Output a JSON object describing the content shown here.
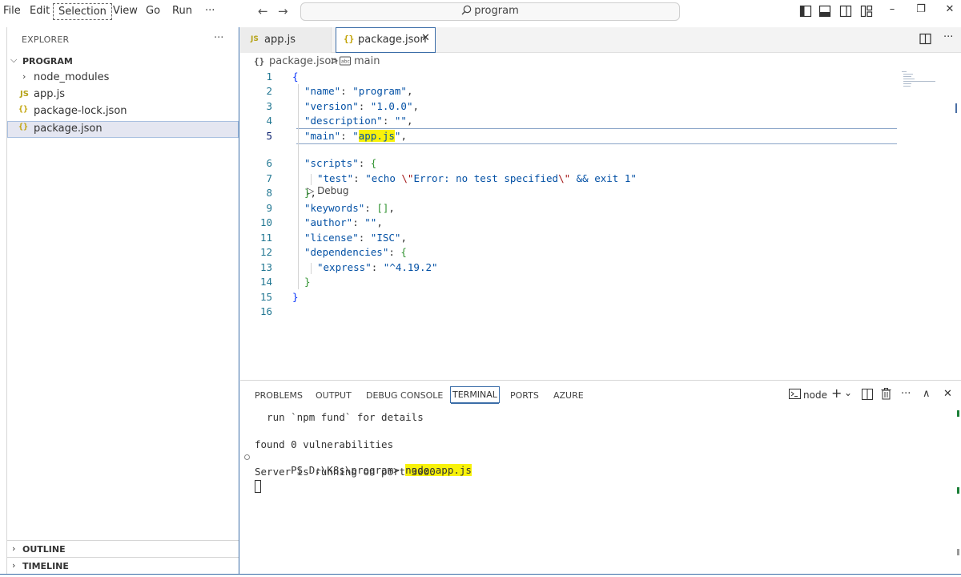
{
  "menu": {
    "items": [
      "File",
      "Edit",
      "Selection",
      "View",
      "Go",
      "Run"
    ],
    "more": "···"
  },
  "nav": {
    "back": "←",
    "forward": "→"
  },
  "command_center": {
    "text": "program"
  },
  "window_controls": {
    "minimize": "–",
    "restore": "❐",
    "close": "✕"
  },
  "sidebar": {
    "title": "EXPLORER",
    "more": "···",
    "folder": "PROGRAM",
    "items": [
      {
        "label": "node_modules",
        "kind": "folder"
      },
      {
        "label": "app.js",
        "kind": "js",
        "icon": "JS"
      },
      {
        "label": "package-lock.json",
        "kind": "json",
        "icon": "{}"
      },
      {
        "label": "package.json",
        "kind": "json",
        "icon": "{}",
        "selected": true
      }
    ],
    "sections": [
      "OUTLINE",
      "TIMELINE"
    ]
  },
  "tabs": [
    {
      "label": "app.js",
      "icon": "JS",
      "active": false
    },
    {
      "label": "package.json",
      "icon": "{}",
      "active": true,
      "close": "✕"
    }
  ],
  "breadcrumb": {
    "file": "package.json",
    "separator": ">",
    "symbol": "main"
  },
  "codelens": {
    "label": "Debug"
  },
  "code": {
    "line_numbers": [
      "1",
      "2",
      "3",
      "4",
      "5",
      "6",
      "7",
      "8",
      "9",
      "10",
      "11",
      "12",
      "13",
      "14",
      "15",
      "16"
    ],
    "active_line": 5
  },
  "panel": {
    "tabs": [
      "PROBLEMS",
      "OUTPUT",
      "DEBUG CONSOLE",
      "TERMINAL",
      "PORTS",
      "AZURE"
    ],
    "active_tab": "TERMINAL",
    "terminal_name": "node",
    "controls": {
      "add": "+",
      "dropdown": "⌄",
      "more": "···",
      "maximize": "∧",
      "close": "✕"
    }
  },
  "terminal": {
    "lines": [
      "  run `npm fund` for details",
      "",
      "found 0 vulnerabilities",
      "PS D:\\K8s\\program> ",
      "Server is running on port 3000"
    ],
    "command": "node app.js"
  },
  "colors": {
    "accent": "#3c6ea8",
    "highlight": "#f8f20a",
    "json_key": "#0451a5",
    "json_string": "#a31515"
  }
}
